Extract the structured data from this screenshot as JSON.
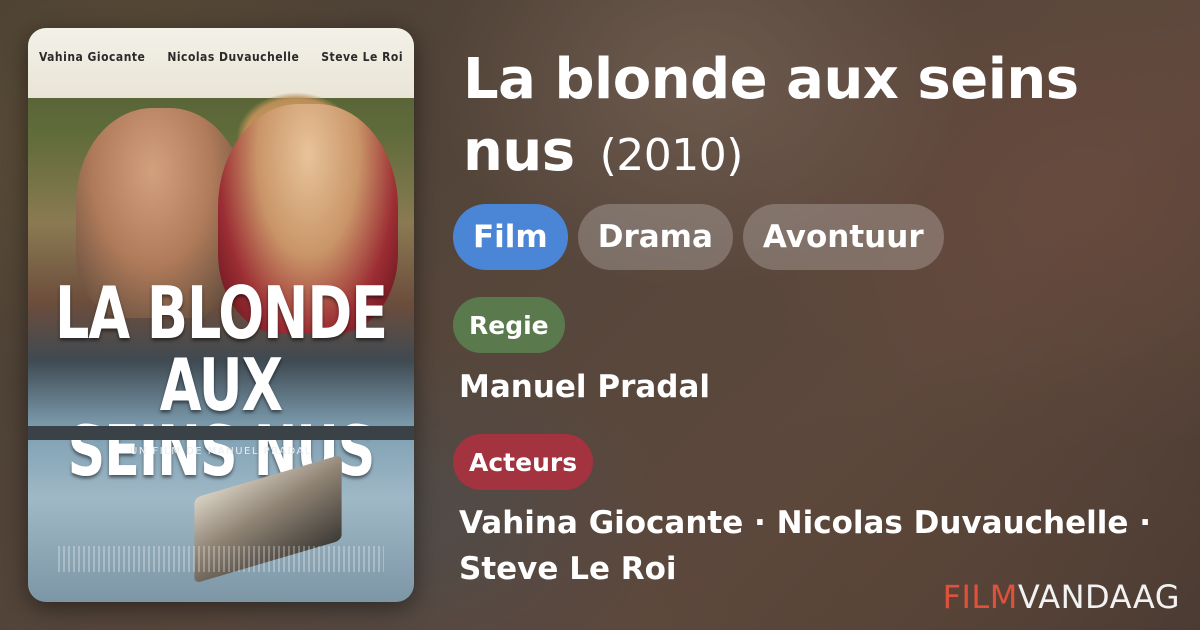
{
  "movie": {
    "title": "La blonde aux seins nus",
    "year": "(2010)"
  },
  "poster": {
    "cast_names": [
      "Vahina Giocante",
      "Nicolas Duvauchelle",
      "Steve Le Roi"
    ],
    "title_line1": "LA BLONDE AUX",
    "title_line2": "SEINS NUS",
    "director_credit": "UN FILM DE MANUEL PRADAL"
  },
  "genres": [
    {
      "label": "Film",
      "color": "#4a85d6"
    },
    {
      "label": "Drama"
    },
    {
      "label": "Avontuur"
    }
  ],
  "director_section": {
    "label": "Regie",
    "color": "#5a7a4e",
    "value": "Manuel Pradal"
  },
  "cast_section": {
    "label": "Acteurs",
    "color": "#a2333f",
    "value": "Vahina Giocante · Nicolas Duvauchelle · Steve Le Roi"
  },
  "brand": {
    "part1": "FILM",
    "part2": "VANDAAG",
    "accent_color": "#e0513c"
  }
}
